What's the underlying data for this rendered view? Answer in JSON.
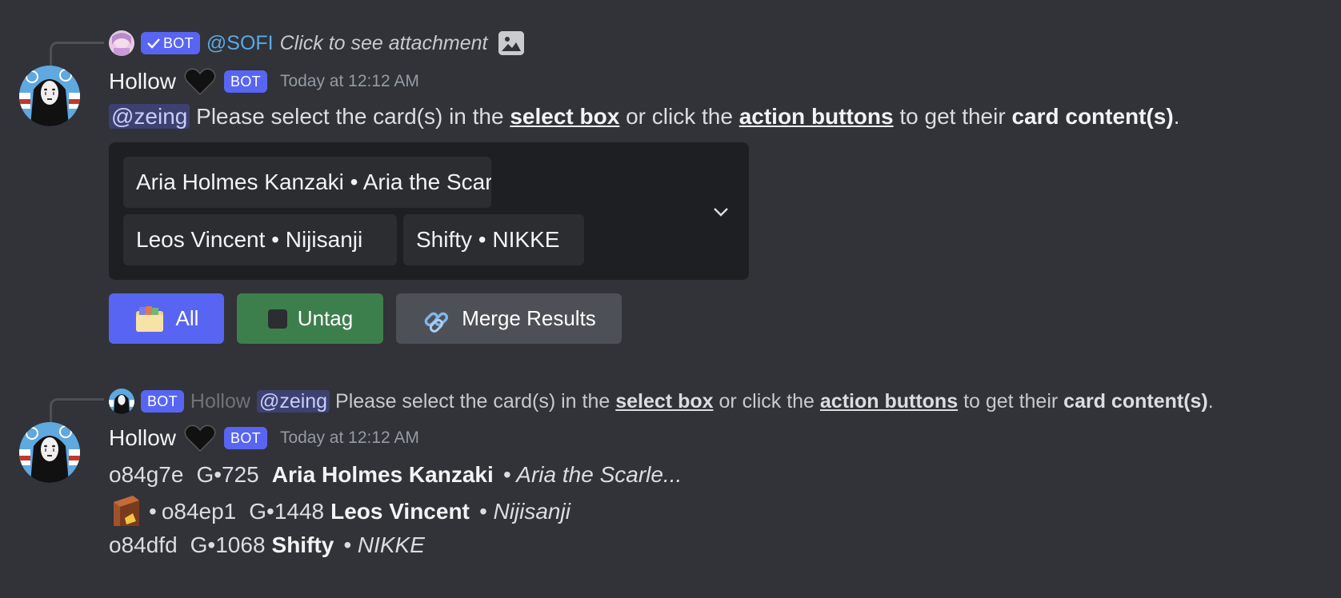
{
  "reply1": {
    "bot_tag": "BOT",
    "mention": "@SOFI",
    "text": "Click to see attachment",
    "icon": "image-icon"
  },
  "message1": {
    "username": "Hollow",
    "heart_icon": "black-heart-icon",
    "bot_tag": "BOT",
    "timestamp": "Today at 12:12 AM",
    "mention": "@zeing",
    "text_part1": "Please select the card(s) in the",
    "text_select_box": "select box",
    "text_part2": "or click the",
    "text_action_buttons": "action buttons",
    "text_part3": "to get their",
    "text_card_content": "card content(s)",
    "text_end": ".",
    "select_box": {
      "chips": [
        "Aria Holmes Kanzaki • Aria the Scarlet Ammo",
        "Leos Vincent • Nijisanji",
        "Shifty • NIKKE"
      ],
      "chevron_icon": "chevron-down-icon"
    },
    "buttons": {
      "all_label": "All",
      "untag_label": "Untag",
      "merge_label": "Merge Results"
    }
  },
  "reply2": {
    "bot_tag": "BOT",
    "username": "Hollow",
    "mention": "@zeing",
    "text_part1": "Please select the card(s) in the",
    "text_select_box": "select box",
    "text_part2": "or click the",
    "text_action_buttons": "action buttons",
    "text_part3": "to get their",
    "text_card_content": "card content(s)",
    "text_end": "."
  },
  "message2": {
    "username": "Hollow",
    "bot_tag": "BOT",
    "timestamp": "Today at 12:12 AM",
    "cards": [
      {
        "prefix": "",
        "code": "o84g7e",
        "gen": "G•725",
        "name": "Aria Holmes Kanzaki",
        "series": "• Aria the Scarle..."
      },
      {
        "prefix": "•",
        "code": "o84ep1",
        "gen": "G•1448",
        "name": "Leos Vincent",
        "series": "• Nijisanji"
      },
      {
        "prefix": "",
        "code": "o84dfd",
        "gen": "G•1068",
        "name": "Shifty",
        "series": "• NIKKE"
      }
    ]
  },
  "colors": {
    "background": "#313338",
    "blurple": "#5865f2",
    "green": "#3d7f4c",
    "grey_button": "#4e5058",
    "select_bg": "#1e1f22"
  }
}
